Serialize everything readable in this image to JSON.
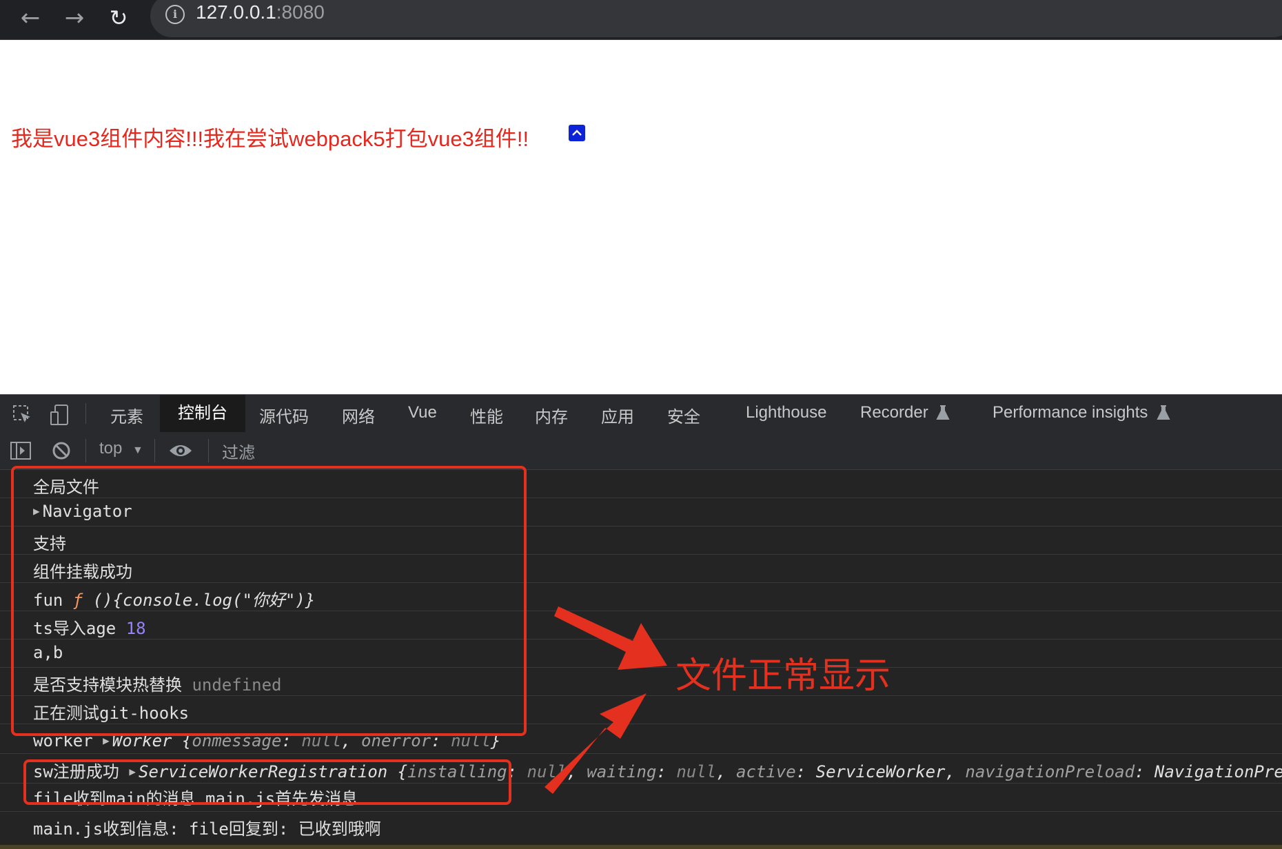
{
  "browser": {
    "back_icon": "←",
    "forward_icon": "→",
    "reload_icon": "↻",
    "url_host": "127.0.0.1",
    "url_port": ":8080"
  },
  "page": {
    "content_text": "我是vue3组件内容!!!我在尝试webpack5打包vue3组件!!"
  },
  "devtools": {
    "tabs": [
      "元素",
      "控制台",
      "源代码",
      "网络",
      "Vue",
      "性能",
      "内存",
      "应用",
      "安全",
      "Lighthouse",
      "Recorder",
      "Performance insights"
    ],
    "active_tab": "控制台",
    "context": "top",
    "filter_placeholder": "过滤"
  },
  "console": {
    "r1": "全局文件",
    "r2": "Navigator",
    "r3": "支持",
    "r4": "组件挂载成功",
    "r5_label": "fun ",
    "r5_f": "ƒ",
    "r5_body": " (){console.log(\"你好\")}",
    "r6_label": "ts导入age ",
    "r6_value": "18",
    "r7": "a,b",
    "r8_label": "是否支持模块热替换 ",
    "r8_value": "undefined",
    "r9": "正在测试git-hooks",
    "r10_label": "worker ",
    "r10_obj": "Worker {",
    "r10_k1": "onmessage",
    "r10_v1": "null",
    "r10_k2": "onerror",
    "r10_v2": "null",
    "r11_label": "sw注册成功 ",
    "r11_obj": "ServiceWorkerRegistration {",
    "r11_k1": "installing",
    "r11_v1": "null",
    "r11_k2": "waiting",
    "r11_v2": "null",
    "r11_k3": "active",
    "r11_v3": "ServiceWorker",
    "r11_k4": "navigationPreload",
    "r11_v4": "NavigationPre",
    "r12": "file收到main的消息 main.js首先发消息",
    "r13": "main.js收到信息:  file回复到: 已收到哦啊"
  },
  "annotation": {
    "text": "文件正常显示",
    "color": "#e4301e"
  }
}
